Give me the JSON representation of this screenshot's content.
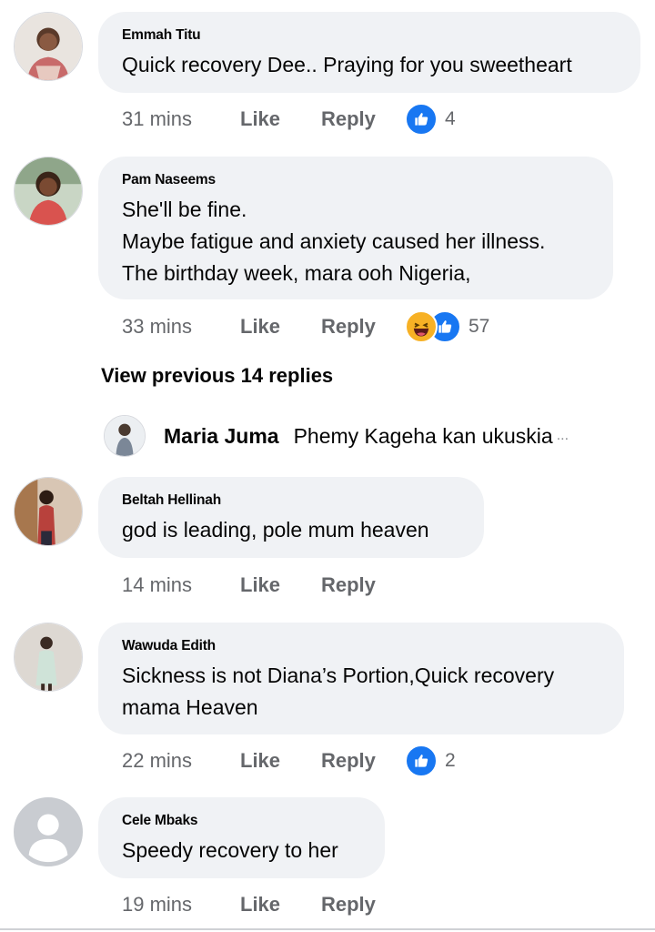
{
  "comments": [
    {
      "name": "Emmah Titu",
      "lines": [
        "Quick recovery Dee.. Praying for you sweetheart"
      ],
      "time": "31 mins",
      "like": "Like",
      "reply": "Reply",
      "reaction_count": "4",
      "reactions": [
        "like-reaction-icon"
      ]
    },
    {
      "name": "Pam Naseems",
      "lines": [
        "She'll be fine.",
        "Maybe fatigue and anxiety caused her illness.",
        "The birthday week, mara ooh Nigeria,"
      ],
      "time": "33 mins",
      "like": "Like",
      "reply": "Reply",
      "reaction_count": "57",
      "reactions": [
        "haha-reaction-icon",
        "like-reaction-icon"
      ]
    },
    {
      "name": "Beltah Hellinah",
      "lines": [
        "god is leading, pole mum heaven"
      ],
      "time": "14 mins",
      "like": "Like",
      "reply": "Reply"
    },
    {
      "name": "Wawuda Edith",
      "lines": [
        "Sickness is not Diana’s Portion,Quick recovery",
        "mama Heaven"
      ],
      "time": "22 mins",
      "like": "Like",
      "reply": "Reply",
      "reaction_count": "2",
      "reactions": [
        "like-reaction-icon"
      ]
    },
    {
      "name": "Cele Mbaks",
      "lines": [
        "Speedy recovery to her"
      ],
      "time": "19 mins",
      "like": "Like",
      "reply": "Reply"
    }
  ],
  "view_previous": "View previous 14 replies",
  "reply_preview": {
    "name": "Maria Juma",
    "text": "Phemy Kageha kan ukuskia",
    "ellipsis": "..."
  },
  "colors": {
    "bubble": "#f0f2f5",
    "meta_text": "#65676b",
    "like_blue": "#1877f2",
    "haha_yellow": "#f7b125"
  }
}
